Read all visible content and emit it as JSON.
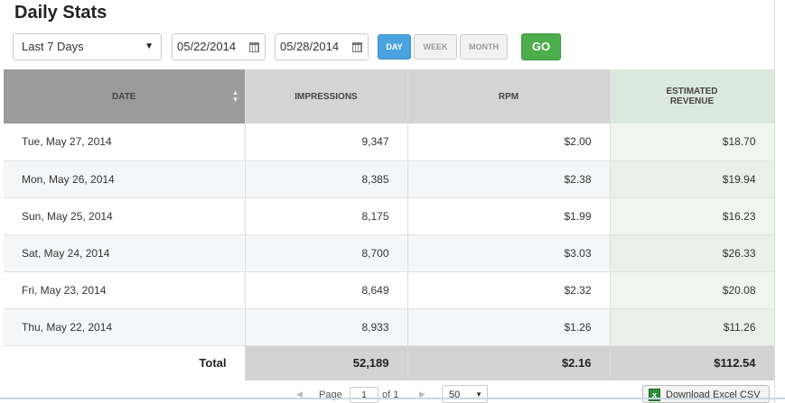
{
  "page": {
    "title": "Daily Stats"
  },
  "filters": {
    "range": "Last 7 Days",
    "start_date": "05/22/2014",
    "end_date": "05/28/2014",
    "granularity": [
      "DAY",
      "WEEK",
      "MONTH"
    ],
    "granularity_selected": "DAY",
    "go_label": "GO"
  },
  "table": {
    "headers": {
      "date": "DATE",
      "impressions": "IMPRESSIONS",
      "rpm": "RPM",
      "revenue_line1": "ESTIMATED",
      "revenue_line2": "REVENUE"
    },
    "rows": [
      {
        "date": "Tue, May 27, 2014",
        "impressions": "9,347",
        "rpm": "$2.00",
        "revenue": "$18.70"
      },
      {
        "date": "Mon, May 26, 2014",
        "impressions": "8,385",
        "rpm": "$2.38",
        "revenue": "$19.94"
      },
      {
        "date": "Sun, May 25, 2014",
        "impressions": "8,175",
        "rpm": "$1.99",
        "revenue": "$16.23"
      },
      {
        "date": "Sat, May 24, 2014",
        "impressions": "8,700",
        "rpm": "$3.03",
        "revenue": "$26.33"
      },
      {
        "date": "Fri, May 23, 2014",
        "impressions": "8,649",
        "rpm": "$2.32",
        "revenue": "$20.08"
      },
      {
        "date": "Thu, May 22, 2014",
        "impressions": "8,933",
        "rpm": "$1.26",
        "revenue": "$11.26"
      }
    ],
    "total": {
      "label": "Total",
      "impressions": "52,189",
      "rpm": "$2.16",
      "revenue": "$112.54"
    }
  },
  "pager": {
    "page_label": "Page",
    "page_value": "1",
    "of_label": "of 1",
    "per_page": "50",
    "download_label": "Download Excel CSV"
  },
  "colors": {
    "day_active": "#4aa3df",
    "go_button": "#4cae4c",
    "date_header": "#9b9b9b",
    "revenue_column": "#eef6ee"
  }
}
